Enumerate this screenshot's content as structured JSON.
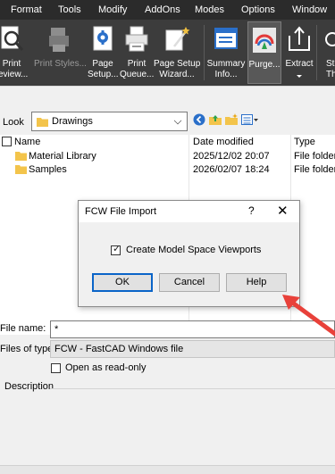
{
  "menu": [
    "Format",
    "Tools",
    "Modify",
    "AddOns",
    "Modes",
    "Options",
    "Window"
  ],
  "ribbon": {
    "buttons": [
      {
        "label1": "Print",
        "label2": "review...",
        "icon": "print-preview-icon"
      },
      {
        "label1": "Print Styles...",
        "label2": "",
        "icon": "print-styles-icon"
      },
      {
        "label1": "Page",
        "label2": "Setup...",
        "icon": "page-setup-icon"
      },
      {
        "label1": "Print",
        "label2": "Queue...",
        "icon": "print-queue-icon"
      },
      {
        "label1": "Page Setup",
        "label2": "Wizard...",
        "icon": "page-setup-wizard-icon"
      },
      {
        "label1": "Summary",
        "label2": "Info...",
        "icon": "summary-info-icon"
      },
      {
        "label1": "Purge...",
        "label2": "",
        "icon": "purge-icon"
      },
      {
        "label1": "Extract",
        "label2": "",
        "icon": "extract-icon"
      },
      {
        "label1": "St",
        "label2": "Thum",
        "icon": "thumbnail-icon"
      }
    ]
  },
  "file_dialog": {
    "look_label": "Look",
    "look_value": "Drawings",
    "columns": {
      "name": "Name",
      "date": "Date modified",
      "type": "Type"
    },
    "rows": [
      {
        "name": "Material Library",
        "date": "2025/12/02 20:07",
        "type": "File folder"
      },
      {
        "name": "Samples",
        "date": "2026/02/07 18:24",
        "type": "File folder"
      }
    ],
    "file_name_label": "File name:",
    "file_name_value": "*",
    "file_type_label": "Files of type:",
    "file_type_value": "FCW - FastCAD Windows file",
    "readonly_label": "Open as read-only",
    "description_label": "Description"
  },
  "modal": {
    "title": "FCW File Import",
    "help_glyph": "?",
    "close_glyph": "✕",
    "checkbox_label": "Create Model Space Viewports",
    "checkbox_checked": true,
    "ok_label": "OK",
    "cancel_label": "Cancel",
    "help_label": "Help"
  },
  "colors": {
    "ribbon_bg": "#3c3c3c",
    "menubar_bg": "#2b2b2b",
    "dialog_bg": "#f0f0f0",
    "accent_blue": "#0a64c8",
    "annotation_arrow": "#e8413a"
  }
}
